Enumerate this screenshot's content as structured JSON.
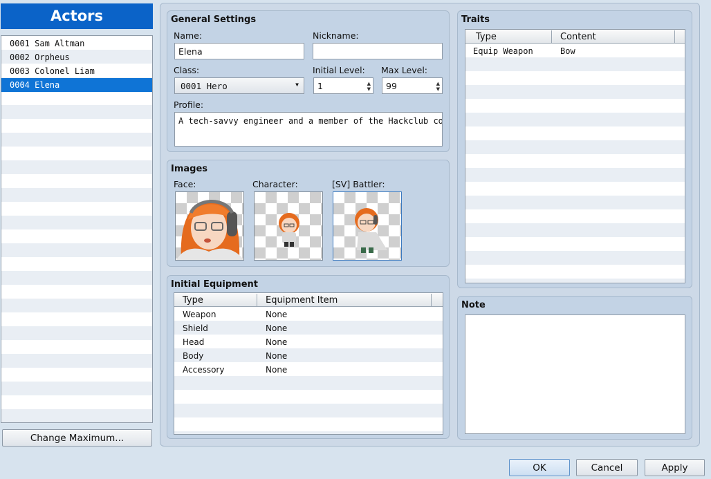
{
  "actors": {
    "header": "Actors",
    "items": [
      "0001 Sam Altman",
      "0002 Orpheus",
      "0003 Colonel Liam",
      "0004 Elena"
    ],
    "selected_index": 3,
    "change_max_label": "Change Maximum..."
  },
  "general": {
    "title": "General Settings",
    "name_label": "Name:",
    "name_value": "Elena",
    "nickname_label": "Nickname:",
    "nickname_value": "",
    "class_label": "Class:",
    "class_value": "0001 Hero",
    "initial_level_label": "Initial Level:",
    "initial_level_value": "1",
    "max_level_label": "Max Level:",
    "max_level_value": "99",
    "profile_label": "Profile:",
    "profile_value": "A tech-savvy engineer and a member of the Hackclub commu"
  },
  "images": {
    "title": "Images",
    "face_label": "Face:",
    "character_label": "Character:",
    "battler_label": "[SV] Battler:"
  },
  "equipment": {
    "title": "Initial Equipment",
    "col_type": "Type",
    "col_item": "Equipment Item",
    "rows": [
      {
        "type": "Weapon",
        "item": "None"
      },
      {
        "type": "Shield",
        "item": "None"
      },
      {
        "type": "Head",
        "item": "None"
      },
      {
        "type": "Body",
        "item": "None"
      },
      {
        "type": "Accessory",
        "item": "None"
      }
    ]
  },
  "traits": {
    "title": "Traits",
    "col_type": "Type",
    "col_content": "Content",
    "rows": [
      {
        "type": "Equip Weapon",
        "content": "Bow"
      }
    ]
  },
  "note": {
    "title": "Note",
    "value": ""
  },
  "buttons": {
    "ok": "OK",
    "cancel": "Cancel",
    "apply": "Apply"
  },
  "colors": {
    "accent": "#0b63c8",
    "selection": "#0f74d6",
    "panel": "#c3d3e5",
    "background": "#d7e3ee"
  },
  "icons": {
    "dropdown": "chevron-down-icon",
    "spinner": "spin-arrows-icon"
  }
}
